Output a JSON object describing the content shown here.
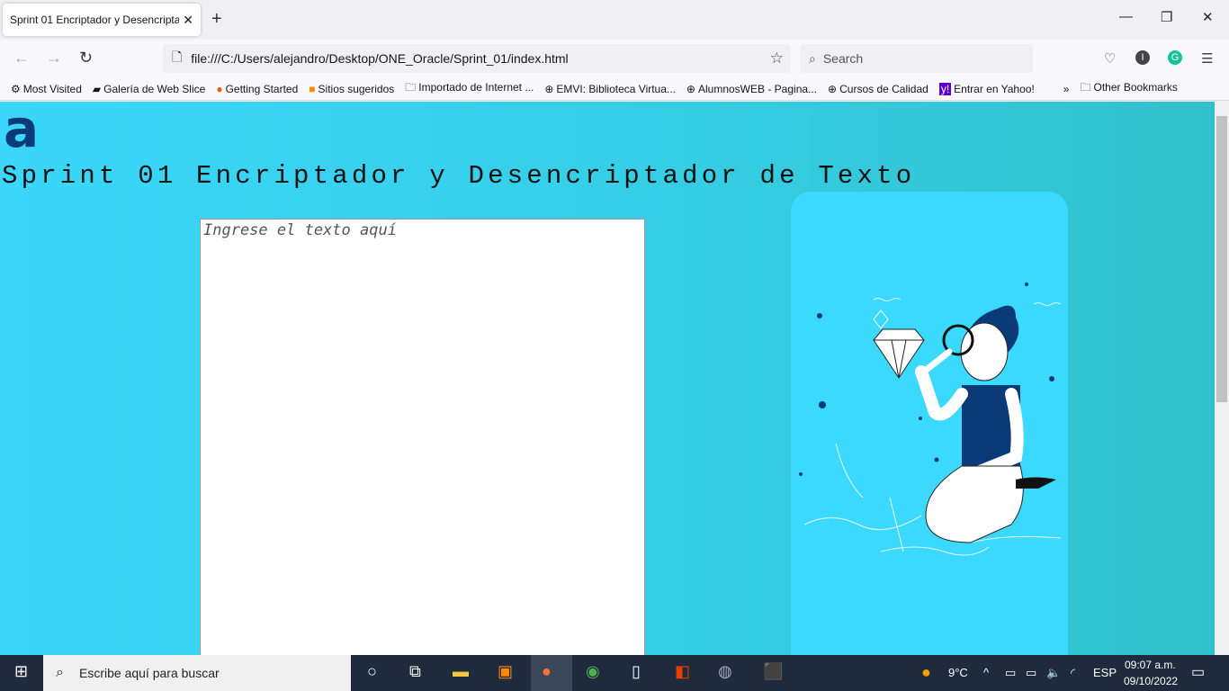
{
  "browser": {
    "tab_title": "Sprint 01 Encriptador y Desencriptador de Texto",
    "url": "file:///C:/Users/alejandro/Desktop/ONE_Oracle/Sprint_01/index.html",
    "search_placeholder": "Search",
    "bookmarks": [
      {
        "label": "Most Visited",
        "icon": "gear-icon"
      },
      {
        "label": "Galería de Web Slice",
        "icon": "webslice-icon"
      },
      {
        "label": "Getting Started",
        "icon": "firefox-icon"
      },
      {
        "label": "Sitios sugeridos",
        "icon": "bulb-icon"
      },
      {
        "label": "Importado de Internet ...",
        "icon": "folder-icon"
      },
      {
        "label": "EMVI: Biblioteca Virtua...",
        "icon": "globe-icon"
      },
      {
        "label": "AlumnosWEB - Pagina...",
        "icon": "globe-icon"
      },
      {
        "label": "Cursos de Calidad",
        "icon": "globe-icon"
      },
      {
        "label": "Entrar en Yahoo!",
        "icon": "yahoo-icon"
      }
    ],
    "other_bookmarks": "Other Bookmarks"
  },
  "page": {
    "logo": "a",
    "title": "Sprint 01 Encriptador y Desencriptador de Texto",
    "textarea_placeholder": "Ingrese el texto aquí",
    "colors": {
      "accent": "#0a3a78",
      "background": "#3ad7fa",
      "card": "#3bd9fd"
    }
  },
  "taskbar": {
    "search_placeholder": "Escribe aquí para buscar",
    "temperature": "9°C",
    "language": "ESP",
    "time": "09:07 a.m.",
    "date": "09/10/2022"
  }
}
